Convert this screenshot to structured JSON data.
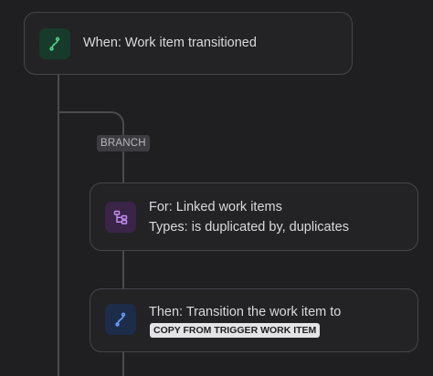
{
  "trigger": {
    "label": "When: Work item transitioned",
    "icon": "trigger-flow-icon"
  },
  "branch": {
    "label": "BRANCH"
  },
  "branch_card": {
    "title": "For: Linked work items",
    "subtitle": "Types: is duplicated by, duplicates",
    "icon": "branch-tree-icon"
  },
  "action": {
    "title": "Then: Transition the work item to",
    "tag": "COPY FROM TRIGGER WORK ITEM",
    "icon": "action-flow-icon"
  },
  "colors": {
    "trigger_accent": "#4fd08a",
    "branch_accent": "#c08cf0",
    "action_accent": "#6aa0ff"
  }
}
